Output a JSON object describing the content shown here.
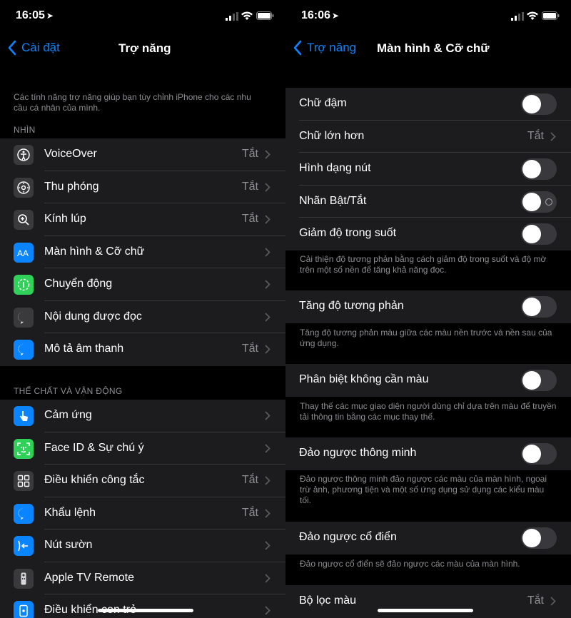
{
  "left": {
    "status": {
      "time": "16:05"
    },
    "nav": {
      "back_label": "Cài đặt",
      "title": "Trợ năng"
    },
    "intro": "Các tính năng trợ năng giúp bạn tùy chỉnh iPhone cho các nhu cầu cá nhân của mình.",
    "section1": {
      "header": "NHÌN",
      "items": [
        {
          "label": "VoiceOver",
          "value": "Tắt",
          "icon": "voiceover-icon",
          "color": "#3a3a3c"
        },
        {
          "label": "Thu phóng",
          "value": "Tắt",
          "icon": "zoom-icon",
          "color": "#3a3a3c"
        },
        {
          "label": "Kính lúp",
          "value": "Tắt",
          "icon": "magnifier-icon",
          "color": "#3a3a3c"
        },
        {
          "label": "Màn hình & Cỡ chữ",
          "value": "",
          "icon": "text-size-icon",
          "color": "#0a84ff"
        },
        {
          "label": "Chuyển động",
          "value": "",
          "icon": "motion-icon",
          "color": "#30d158"
        },
        {
          "label": "Nội dung được đọc",
          "value": "",
          "icon": "spoken-content-icon",
          "color": "#3a3a3c"
        },
        {
          "label": "Mô tả âm thanh",
          "value": "Tắt",
          "icon": "audio-description-icon",
          "color": "#0a84ff"
        }
      ]
    },
    "section2": {
      "header": "THỂ CHẤT VÀ VẬN ĐỘNG",
      "items": [
        {
          "label": "Cảm ứng",
          "value": "",
          "icon": "touch-icon",
          "color": "#0a84ff"
        },
        {
          "label": "Face ID & Sự chú ý",
          "value": "",
          "icon": "face-id-icon",
          "color": "#30d158"
        },
        {
          "label": "Điều khiển công tắc",
          "value": "Tắt",
          "icon": "switch-control-icon",
          "color": "#3a3a3c"
        },
        {
          "label": "Khẩu lệnh",
          "value": "Tắt",
          "icon": "voice-control-icon",
          "color": "#0a84ff"
        },
        {
          "label": "Nút sườn",
          "value": "",
          "icon": "side-button-icon",
          "color": "#0a84ff"
        },
        {
          "label": "Apple TV Remote",
          "value": "",
          "icon": "tv-remote-icon",
          "color": "#3a3a3c"
        },
        {
          "label": "Điều khiển con trỏ",
          "value": "",
          "icon": "pointer-control-icon",
          "color": "#0a84ff"
        }
      ]
    }
  },
  "right": {
    "status": {
      "time": "16:06"
    },
    "nav": {
      "back_label": "Trợ năng",
      "title": "Màn hình & Cỡ chữ"
    },
    "group1": [
      {
        "label": "Chữ đậm",
        "type": "toggle"
      },
      {
        "label": "Chữ lớn hơn",
        "type": "link",
        "value": "Tắt"
      },
      {
        "label": "Hình dạng nút",
        "type": "toggle"
      },
      {
        "label": "Nhãn Bật/Tắt",
        "type": "toggle"
      },
      {
        "label": "Giảm độ trong suốt",
        "type": "toggle"
      }
    ],
    "note1": "Cải thiện độ tương phản bằng cách giảm độ trong suốt và độ mờ trên một số nền để tăng khả năng đọc.",
    "contrast": {
      "label": "Tăng độ tương phản",
      "note": "Tăng độ tương phản màu giữa các màu nền trước và nền sau của ứng dụng."
    },
    "differentiate": {
      "label": "Phân biệt không cần màu",
      "note": "Thay thế các mục giao diện người dùng chỉ dựa trên màu để truyền tải thông tin bằng các mục thay thế."
    },
    "smart_invert": {
      "label": "Đảo ngược thông minh",
      "note": "Đảo ngược thông minh đảo ngược các màu của màn hình, ngoại trừ ảnh, phương tiện và một số ứng dụng sử dụng các kiểu màu tối."
    },
    "classic_invert": {
      "label": "Đảo ngược cổ điển",
      "note": "Đảo ngược cổ điển sẽ đảo ngược các màu của màn hình."
    },
    "color_filters": {
      "label": "Bộ lọc màu",
      "value": "Tắt"
    }
  }
}
